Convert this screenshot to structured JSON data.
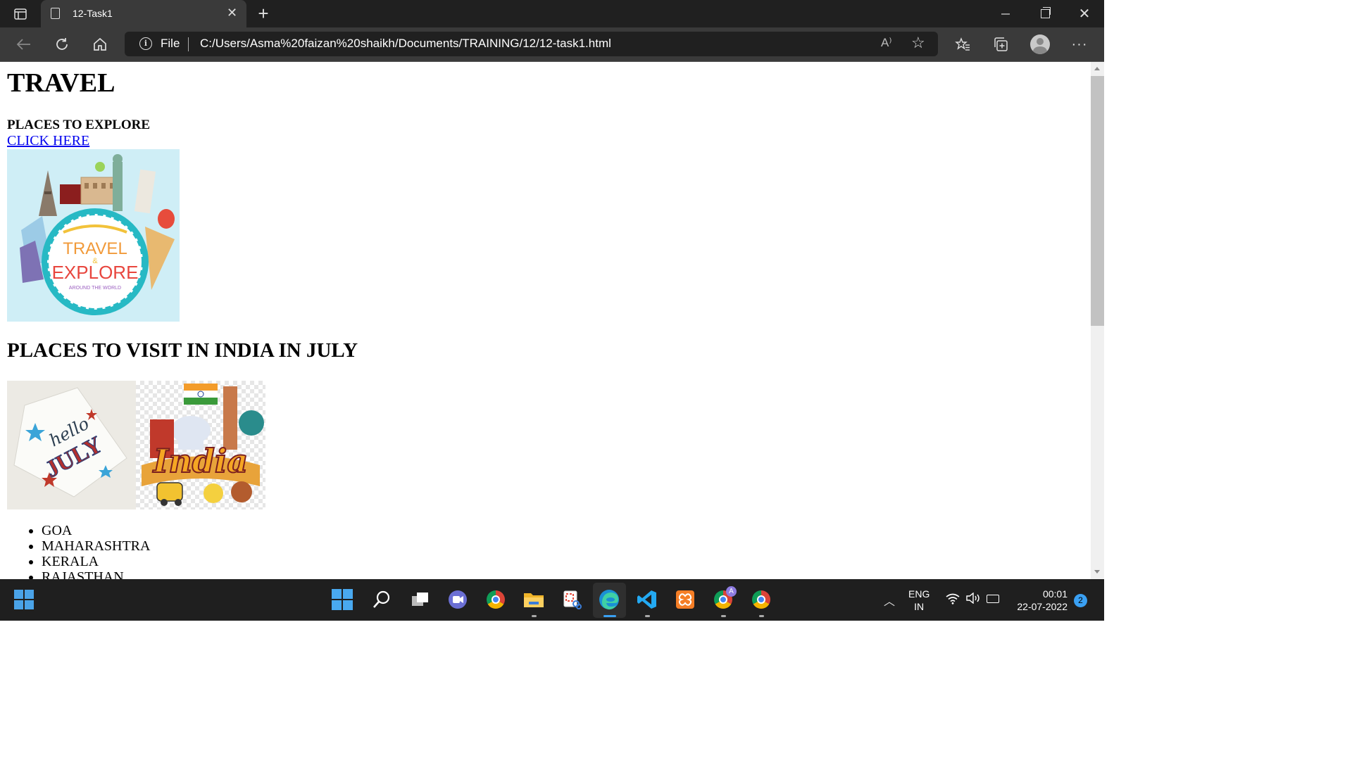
{
  "browser": {
    "tab_title": "12-Task1",
    "address_prefix": "File",
    "url": "C:/Users/Asma%20faizan%20shaikh/Documents/TRAINING/12/12-task1.html"
  },
  "page": {
    "heading": "TRAVEL",
    "subheading": "PLACES TO EXPLORE",
    "link_text": "CLICK HERE",
    "image_travel": {
      "line1": "TRAVEL",
      "ampersand": "&",
      "line2": "EXPLORE",
      "tagline": "AROUND THE WORLD"
    },
    "section_heading": "PLACES TO VISIT IN INDIA IN JULY",
    "image_july": {
      "script": "hello",
      "word": "JULY"
    },
    "image_india": {
      "word": "India"
    },
    "states": [
      "GOA",
      "MAHARASHTRA",
      "KERALA",
      "RAJASTHAN"
    ]
  },
  "taskbar": {
    "language": "ENG",
    "region": "IN",
    "time": "00:01",
    "date": "22-07-2022",
    "notification_count": "2",
    "profile_badge": "A"
  },
  "colors": {
    "link": "#0000ee",
    "accent": "#3aa0f3",
    "titlebar": "#202020",
    "toolbar": "#3a3a3a",
    "taskbar": "#1f1f1f"
  }
}
